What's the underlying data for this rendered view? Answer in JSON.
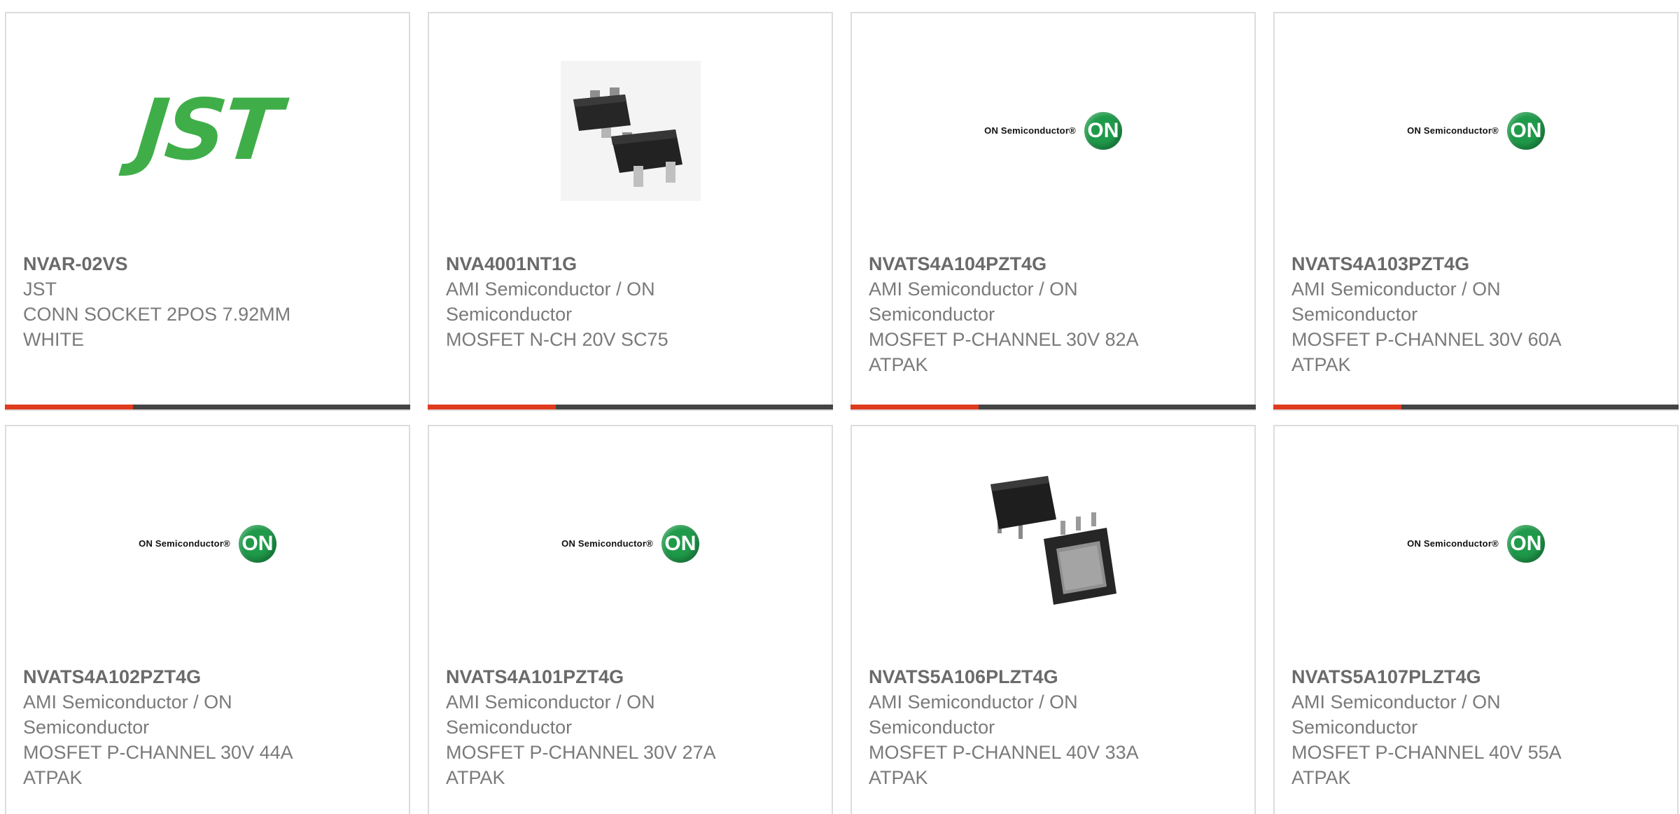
{
  "colors": {
    "accent_bar": "#e03a1e",
    "dark_bar": "#444444",
    "jst_green": "#3fae49",
    "on_green": "#1f9a4a",
    "card_border": "#dcdcdc",
    "text_gray": "#7a7a7a"
  },
  "products": [
    {
      "part": "NVAR-02VS",
      "manufacturer": "JST",
      "description": "CONN SOCKET 2POS 7.92MM WHITE",
      "image_type": "jst-logo",
      "logo_text": "JST"
    },
    {
      "part": "NVA4001NT1G",
      "manufacturer": "AMI Semiconductor / ON Semiconductor",
      "description": "MOSFET N-CH 20V SC75",
      "image_type": "sc75-package-photo"
    },
    {
      "part": "NVATS4A104PZT4G",
      "manufacturer": "AMI Semiconductor / ON Semiconductor",
      "description": "MOSFET P-CHANNEL 30V 82A ATPAK",
      "image_type": "on-semiconductor-logo",
      "logo_text": "ON Semiconductor®",
      "logo_mark": "ON"
    },
    {
      "part": "NVATS4A103PZT4G",
      "manufacturer": "AMI Semiconductor / ON Semiconductor",
      "description": "MOSFET P-CHANNEL 30V 60A ATPAK",
      "image_type": "on-semiconductor-logo",
      "logo_text": "ON Semiconductor®",
      "logo_mark": "ON"
    },
    {
      "part": "NVATS4A102PZT4G",
      "manufacturer": "AMI Semiconductor / ON Semiconductor",
      "description": "MOSFET P-CHANNEL 30V 44A ATPAK",
      "image_type": "on-semiconductor-logo",
      "logo_text": "ON Semiconductor®",
      "logo_mark": "ON"
    },
    {
      "part": "NVATS4A101PZT4G",
      "manufacturer": "AMI Semiconductor / ON Semiconductor",
      "description": "MOSFET P-CHANNEL 30V 27A ATPAK",
      "image_type": "on-semiconductor-logo",
      "logo_text": "ON Semiconductor®",
      "logo_mark": "ON"
    },
    {
      "part": "NVATS5A106PLZT4G",
      "manufacturer": "AMI Semiconductor / ON Semiconductor",
      "description": "MOSFET P-CHANNEL 40V 33A ATPAK",
      "image_type": "atpak-package-photo"
    },
    {
      "part": "NVATS5A107PLZT4G",
      "manufacturer": "AMI Semiconductor / ON Semiconductor",
      "description": "MOSFET P-CHANNEL 40V 55A ATPAK",
      "image_type": "on-semiconductor-logo",
      "logo_text": "ON Semiconductor®",
      "logo_mark": "ON"
    }
  ]
}
